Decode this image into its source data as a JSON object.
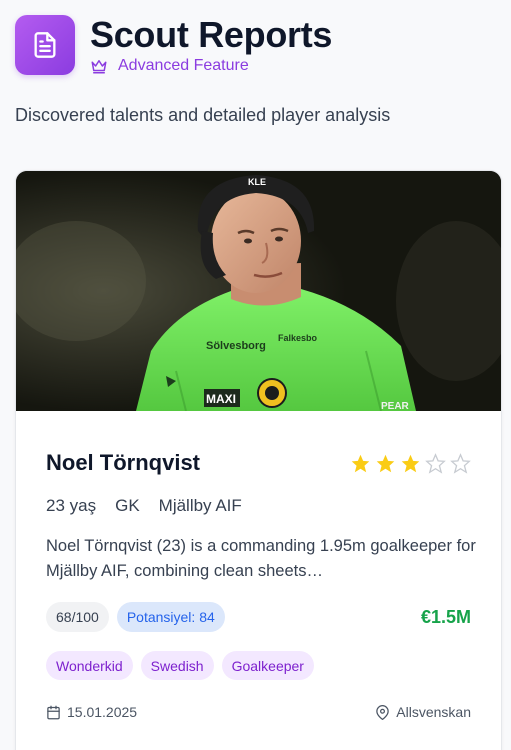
{
  "header": {
    "title": "Scout Reports",
    "feature_label": "Advanced Feature",
    "subtitle": "Discovered talents and detailed player analysis"
  },
  "colors": {
    "accent_purple": "#8b3ce0",
    "star_filled": "#facc15",
    "star_empty": "#d1d5db",
    "value_green": "#16a34a",
    "potential_blue": "#2563eb"
  },
  "report": {
    "player_name": "Noel Törnqvist",
    "rating": 3,
    "rating_max": 5,
    "age": "23 yaş",
    "position": "GK",
    "club": "Mjällby AIF",
    "description": "Noel Törnqvist (23) is a commanding 1.95m goalkeeper for Mjällby AIF, combining clean sheets…",
    "score": "68/100",
    "potential": "Potansiyel: 84",
    "market_value": "€1.5M",
    "tags": [
      "Wonderkid",
      "Swedish",
      "Goalkeeper"
    ],
    "date": "15.01.2025",
    "league": "Allsvenskan"
  }
}
